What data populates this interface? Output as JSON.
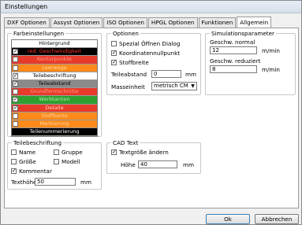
{
  "window": {
    "title": "Einstellungen"
  },
  "tabs": [
    {
      "label": "DXF Optionen"
    },
    {
      "label": "Assyst Optionen"
    },
    {
      "label": "ISO Optionen"
    },
    {
      "label": "HPGL Optionen"
    },
    {
      "label": "Funktionen"
    },
    {
      "label": "Allgemein"
    }
  ],
  "farbeinstellungen": {
    "title": "Farbeinstellungen",
    "items": [
      {
        "label": "Hintergrund",
        "checked": null,
        "bg": "#ffffff",
        "fg": "#000000"
      },
      {
        "label": "red. Geschwindigkeit",
        "checked": true,
        "bg": "#000000",
        "fg": "#ff3030"
      },
      {
        "label": "Konturpunkte",
        "checked": false,
        "bg": "#e83a2a",
        "fg": "#ff9a80"
      },
      {
        "label": "Leerwege",
        "checked": false,
        "bg": "#ff8a1a",
        "fg": "#ffd6a0"
      },
      {
        "label": "Teilebeschriftung",
        "checked": true,
        "bg": "#ffffff",
        "fg": "#000000"
      },
      {
        "label": "Teileabstand",
        "checked": true,
        "bg": "#8a8a8a",
        "fg": "#000000"
      },
      {
        "label": "Grundformschnitte",
        "checked": false,
        "bg": "#e83a2a",
        "fg": "#ff9a80"
      },
      {
        "label": "Werkkanten",
        "checked": true,
        "bg": "#2fa02f",
        "fg": "#a8e8a8"
      },
      {
        "label": "Detaile",
        "checked": true,
        "bg": "#e83a2a",
        "fg": "#ffd0c0"
      },
      {
        "label": "Stoffkante",
        "checked": false,
        "bg": "#ff8a1a",
        "fg": "#ffd6a0"
      },
      {
        "label": "Markierung",
        "checked": false,
        "bg": "#ff8a1a",
        "fg": "#ffd6a0"
      },
      {
        "label": "Teilenummerierung",
        "checked": null,
        "bg": "#000000",
        "fg": "#ffffff"
      }
    ]
  },
  "optionen": {
    "title": "Optionen",
    "spezial": {
      "label": "Spezial Öffnen Dialog",
      "checked": false
    },
    "koordinaten": {
      "label": "Koordinatennullpunkt",
      "checked": true
    },
    "stoffbreite": {
      "label": "Stoffbreite",
      "checked": true
    },
    "teileabstand_label": "Teileabstand",
    "teileabstand_value": "0",
    "teileabstand_unit": "mm",
    "masseinheit_label": "Masseinheit",
    "masseinheit_value": "metrisch CM"
  },
  "simulation": {
    "title": "Simulationsparameter",
    "normal_label": "Geschw. normal",
    "normal_value": "12",
    "normal_unit": "m/min",
    "reduziert_label": "Geschw. reduziert",
    "reduziert_value": "8",
    "reduziert_unit": "m/min"
  },
  "teilebeschriftung": {
    "title": "Teilebeschriftung",
    "name": {
      "label": "Name",
      "checked": false
    },
    "gruppe": {
      "label": "Gruppe",
      "checked": false
    },
    "groesse": {
      "label": "Größe",
      "checked": false
    },
    "modell": {
      "label": "Modell",
      "checked": false
    },
    "kommentar": {
      "label": "Kommentar",
      "checked": true
    },
    "textHoehe_label": "Texthöhe",
    "textHoehe_value": "50",
    "textHoehe_unit": "mm"
  },
  "cadtext": {
    "title": "CAD Text",
    "textgroesse": {
      "label": "Textgröße ändern",
      "checked": true
    },
    "hoehe_label": "Höhe",
    "hoehe_value": "40",
    "hoehe_unit": "mm"
  },
  "buttons": {
    "ok": "Ok",
    "abbrechen": "Abbrechen"
  }
}
